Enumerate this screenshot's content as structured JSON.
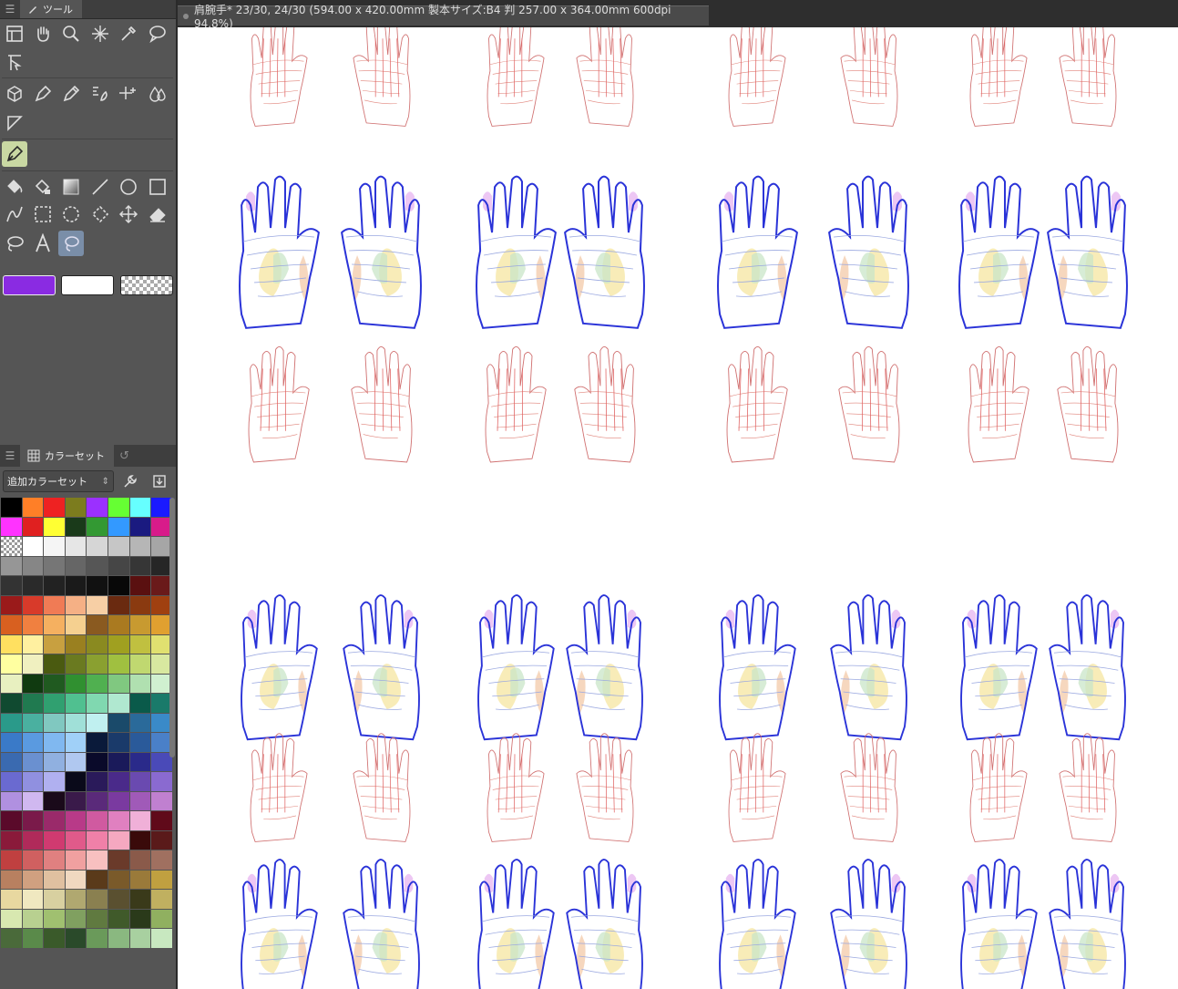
{
  "tool_panel": {
    "tab_label": "ツール"
  },
  "color_panel": {
    "tab_label": "カラーセット",
    "set_name": "追加カラーセット",
    "swatches": [
      "#000000",
      "#ff7f27",
      "#ee2222",
      "#7c7c1e",
      "#9b30ff",
      "#66ff33",
      "#66ffff",
      "#1a1aff",
      "#ff33ff",
      "#e02020",
      "#ffff33",
      "#1a3a1a",
      "#339933",
      "#3399ff",
      "#1a1a80",
      "#d81b8a",
      "transparent",
      "#ffffff",
      "#f5f5f5",
      "#e6e6e6",
      "#d6d6d6",
      "#c6c6c6",
      "#b6b6b6",
      "#a6a6a6",
      "#969696",
      "#868686",
      "#767676",
      "#666666",
      "#565656",
      "#464646",
      "#363636",
      "#262626",
      "#333333",
      "#2a2a2a",
      "#222222",
      "#1a1a1a",
      "#111111",
      "#080808",
      "#5a1010",
      "#6a1a1a",
      "#9a1a1a",
      "#d83a2a",
      "#f07b55",
      "#f5b085",
      "#f7cfa5",
      "#6a2a10",
      "#8a3a10",
      "#a04010",
      "#d86020",
      "#f08040",
      "#f5b060",
      "#f5d090",
      "#8a5a20",
      "#aa7a20",
      "#c89a30",
      "#e0a030",
      "#ffe060",
      "#fff0a0",
      "#c8a040",
      "#9a8020",
      "#8a8a20",
      "#a0a020",
      "#c0c040",
      "#e0e070",
      "#ffffa0",
      "#f0f0c0",
      "#4a5a10",
      "#6a7a20",
      "#8aa030",
      "#a0c040",
      "#c0d870",
      "#d8e8a0",
      "#e8f0c0",
      "#103a10",
      "#205a20",
      "#309030",
      "#50b050",
      "#80c880",
      "#b0e0b0",
      "#d0f0d0",
      "#104a30",
      "#207a50",
      "#30a070",
      "#50c090",
      "#80d8b0",
      "#b0e8d0",
      "#0a5a4a",
      "#1a7a6a",
      "#2a9a8a",
      "#4ab0a0",
      "#80c8c0",
      "#a0e0d8",
      "#c0f0f0",
      "#1a4a6a",
      "#2a6a9a",
      "#3a8ac8",
      "#3a7ac8",
      "#5a9ae0",
      "#80b8f0",
      "#a0d0f8",
      "#0a1a3a",
      "#1a3a6a",
      "#2a5a9a",
      "#4a80c8",
      "#3a6ab0",
      "#6a90d0",
      "#90b0e0",
      "#b0c8f0",
      "#0a0a2a",
      "#1a1a5a",
      "#2a2a8a",
      "#4a4ab8",
      "#6a6ad0",
      "#9090e0",
      "#b0b0f0",
      "#0a0a1a",
      "#2a1a5a",
      "#4a2a8a",
      "#6a4ab0",
      "#8a6ad0",
      "#b090e0",
      "#d0b8f0",
      "#1a0a1a",
      "#3a1a4a",
      "#5a2a7a",
      "#7a3aa0",
      "#a05ab8",
      "#c080d0",
      "#5a0a2a",
      "#7a1a4a",
      "#9a2a6a",
      "#b83a88",
      "#d05aa0",
      "#e080c0",
      "#f0b0d8",
      "#600a1a",
      "#8a1a3a",
      "#b02a5a",
      "#d03a70",
      "#e05a8a",
      "#f080a8",
      "#f5a8c0",
      "#3a0a0a",
      "#5a1a1a",
      "#c04040",
      "#d06060",
      "#e08080",
      "#f0a0a0",
      "#f8c0c0",
      "#6a3a2a",
      "#8a5a4a",
      "#a07060",
      "#b88060",
      "#d0a080",
      "#e0c0a0",
      "#f0d8c0",
      "#5a3a1a",
      "#7a5a2a",
      "#9a7a3a",
      "#c0a040",
      "#e8d8a0",
      "#f0e8c0",
      "#d8d0a0",
      "#b0a870",
      "#8a8050",
      "#5a5030",
      "#3a3a1a",
      "#c0b060",
      "#d8e8b0",
      "#b8d090",
      "#a0c070",
      "#80a060",
      "#607a40",
      "#405a2a",
      "#2a3a1a",
      "#90b060",
      "#4a6a3a",
      "#5a8a4a",
      "#3a5a2a",
      "#2a4a2a",
      "#6a9a5a",
      "#8ab880",
      "#a8d0a0",
      "#c8e8c0"
    ]
  },
  "document": {
    "title": "肩腕手* 23/30, 24/30 (594.00 x 420.00mm 製本サイズ:B4 判 257.00 x 364.00mm 600dpi 94.8%)"
  },
  "colors": {
    "main_color": "#8a2be2",
    "sub_color": "#ffffff"
  }
}
